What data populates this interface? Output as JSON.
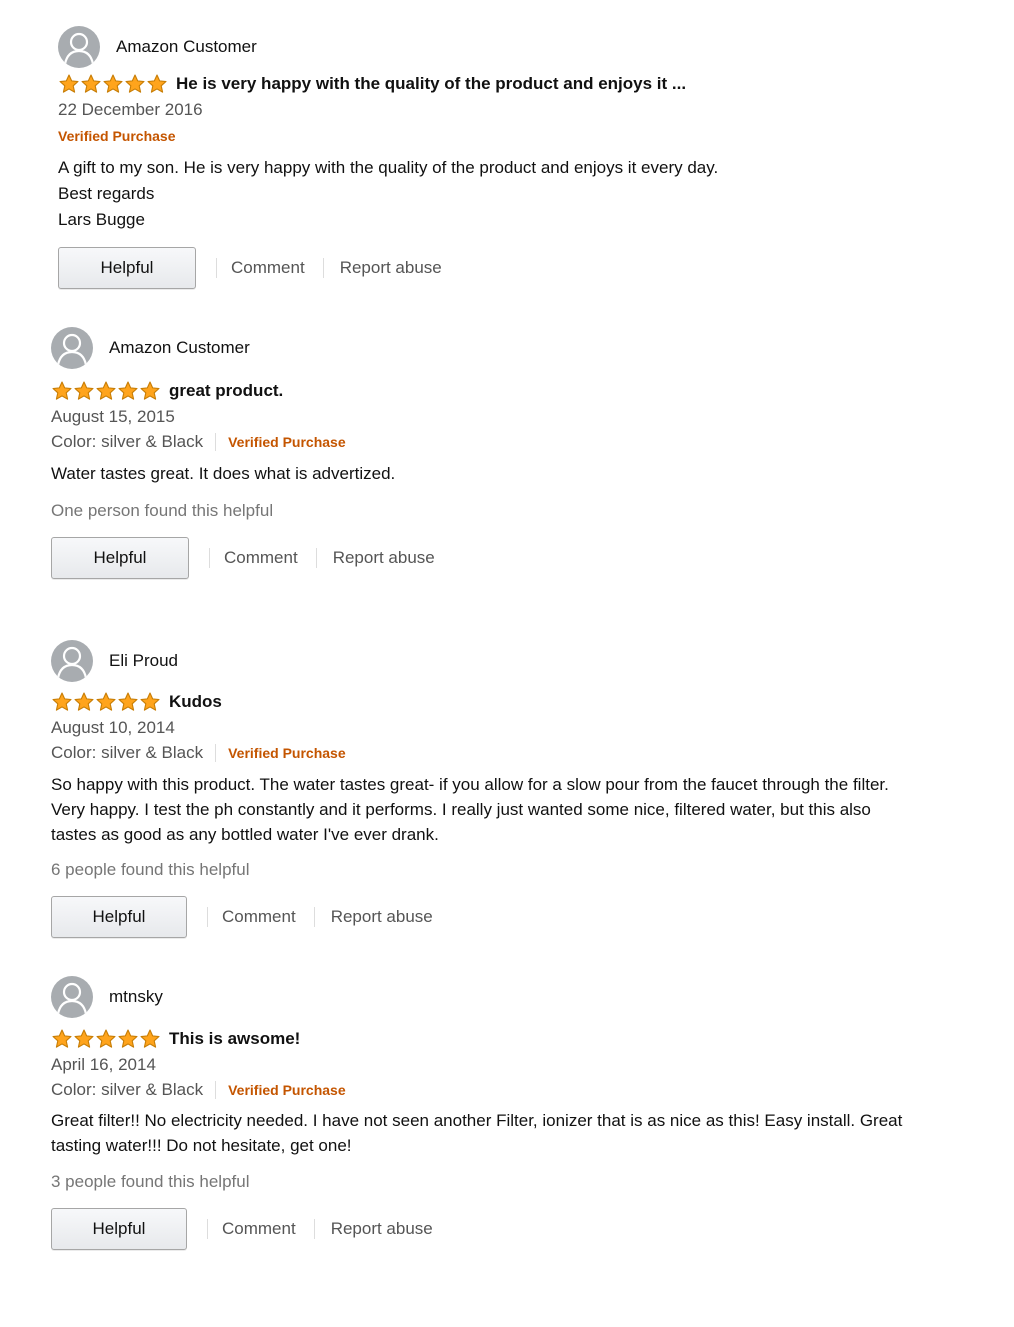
{
  "colors": {
    "star": "#FFA41C",
    "verified": "#c45500",
    "avatar": "#a8acb0"
  },
  "actions": {
    "helpful_label": "Helpful",
    "comment_label": "Comment",
    "report_label": "Report abuse"
  },
  "reviews": [
    {
      "author": "Amazon Customer",
      "rating": 5,
      "title": "He is very happy with the quality of the product and enjoys it ...",
      "date": "22 December 2016",
      "color": "",
      "verified": "Verified Purchase",
      "body": [
        "A gift to my son. He is very happy with the quality of the product and enjoys it every day.",
        "Best regards",
        "Lars Bugge"
      ],
      "helpful_count": ""
    },
    {
      "author": "Amazon Customer",
      "rating": 5,
      "title": "great product.",
      "date": "August 15, 2015",
      "color": "Color: silver & Black",
      "verified": "Verified Purchase",
      "body": [
        "Water tastes great. It does what is advertized."
      ],
      "helpful_count": "One person found this helpful"
    },
    {
      "author": "Eli Proud",
      "rating": 5,
      "title": "Kudos",
      "date": "August 10, 2014",
      "color": "Color: silver & Black",
      "verified": "Verified Purchase",
      "body": [
        "So happy with this product. The water tastes great- if you allow for a slow pour from the faucet through the filter.",
        "Very happy. I test the ph constantly and it performs. I really just wanted some nice, filtered water, but this also",
        "tastes as good as any bottled water I've ever drank."
      ],
      "helpful_count": "6 people found this helpful"
    },
    {
      "author": "mtnsky",
      "rating": 5,
      "title": "This is awsome!",
      "date": "April 16, 2014",
      "color": "Color: silver & Black",
      "verified": "Verified Purchase",
      "body": [
        "Great filter!! No electricity needed. I have not seen another Filter, ionizer that is as nice as this! Easy install. Great",
        "tasting water!!! Do not hesitate, get one!"
      ],
      "helpful_count": "3 people found this helpful"
    }
  ]
}
